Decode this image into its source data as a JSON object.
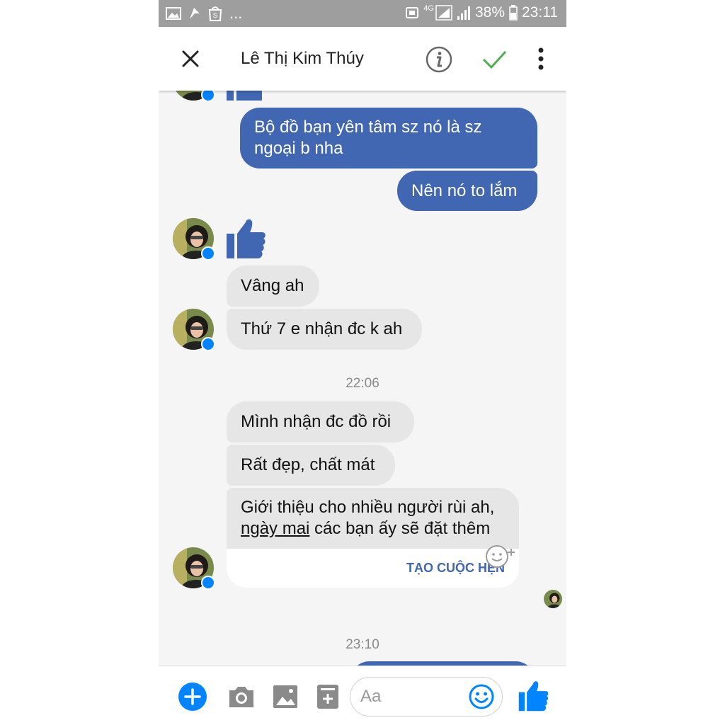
{
  "status_bar": {
    "network": "4G",
    "battery": "38%",
    "time": "23:11",
    "more": "..."
  },
  "header": {
    "contact_name": "Lê Thị Kim Thúy"
  },
  "chat": {
    "outgoing_1_line1": "Bộ đồ bạn yên tâm sz nó là sz",
    "outgoing_1_line2": "ngoại b nha",
    "outgoing_2": "Nên nó to lắm",
    "incoming_1": "Vâng ah",
    "incoming_2": "Thứ 7 e nhận đc k ah",
    "timestamp_1": "22:06",
    "incoming_3": "Mình nhận đc đồ rồi",
    "incoming_4": "Rất đẹp, chất mát",
    "incoming_5_line1": "Giới thiệu cho nhiều người rùi ah,",
    "incoming_5_link": "ngày mai",
    "incoming_5_rest": " các bạn ấy sẽ đặt thêm",
    "schedule_action": "TẠO CUỘC HẸN",
    "timestamp_2": "23:10"
  },
  "composer": {
    "placeholder": "Aa"
  },
  "colors": {
    "accent": "#4267b2",
    "messenger_blue": "#0084ff",
    "incoming_bubble": "#e6e6e6",
    "check_green": "#4caf50"
  }
}
